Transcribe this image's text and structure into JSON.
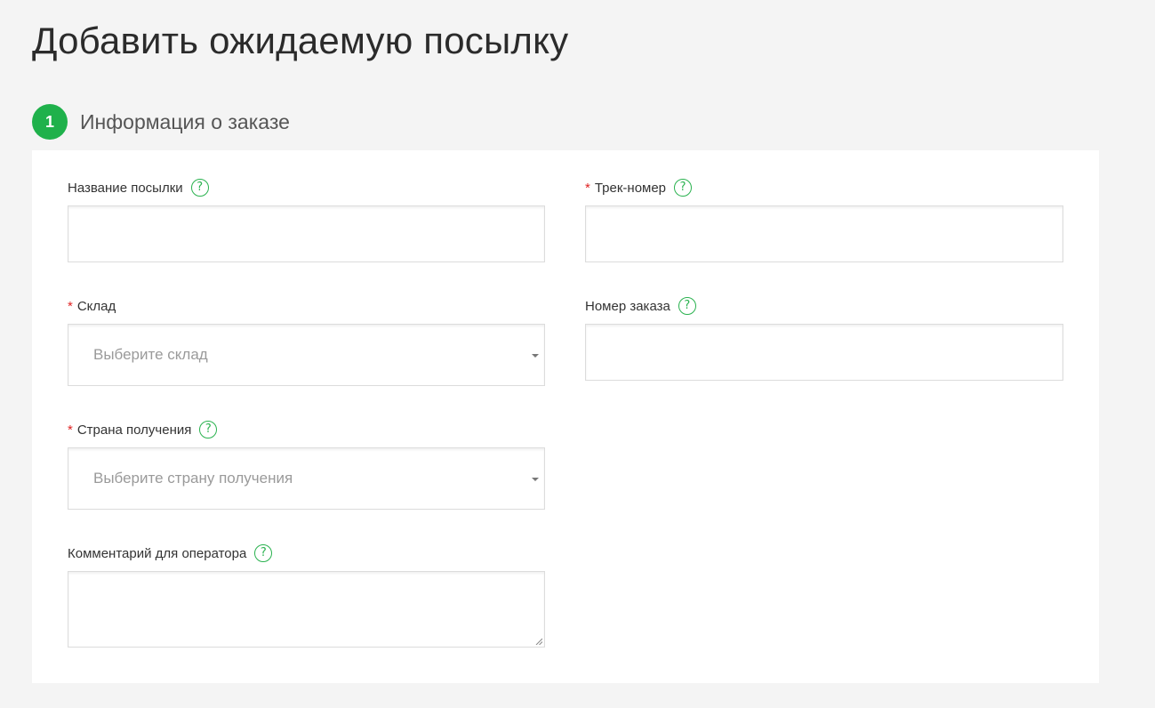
{
  "page": {
    "title": "Добавить ожидаемую посылку"
  },
  "step": {
    "number": "1",
    "title": "Информация о заказе"
  },
  "form": {
    "parcel_name": {
      "label": "Название посылки",
      "value": "",
      "required": false
    },
    "track_number": {
      "label": "Трек-номер",
      "value": "",
      "required": true,
      "required_mark": "*"
    },
    "warehouse": {
      "label": "Склад",
      "placeholder": "Выберите склад",
      "required": true,
      "required_mark": "*"
    },
    "order_number": {
      "label": "Номер заказа",
      "value": "",
      "required": false
    },
    "destination_country": {
      "label": "Страна получения",
      "placeholder": "Выберите страну получения",
      "required": true,
      "required_mark": "*"
    },
    "operator_comment": {
      "label": "Комментарий для оператора",
      "value": "",
      "required": false
    }
  },
  "icons": {
    "help": "question-circle-icon",
    "caret": "caret-down-icon",
    "resize": "resize-grip-icon"
  },
  "help_glyph": "?",
  "colors": {
    "accent": "#1fb14b",
    "required": "#e02424",
    "background": "#f4f4f4",
    "card": "#ffffff"
  }
}
